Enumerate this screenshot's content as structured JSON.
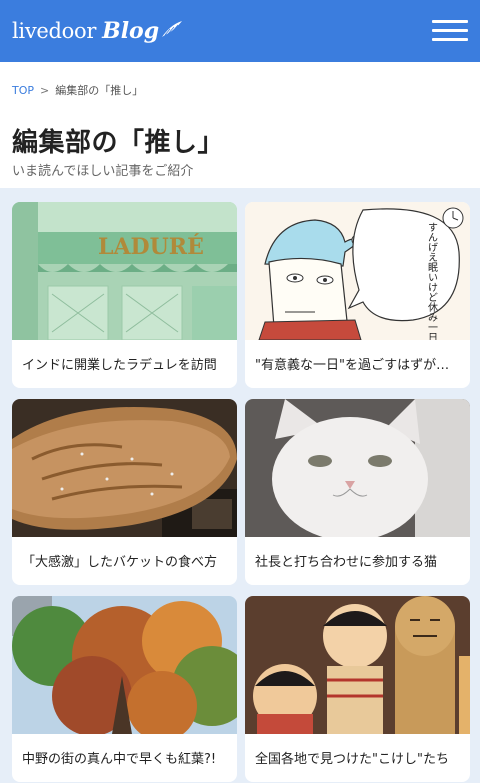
{
  "header": {
    "logo_text": "livedoor",
    "logo_blog": "Blog",
    "menu_icon": "hamburger-menu-icon"
  },
  "breadcrumb": {
    "top_label": "TOP",
    "separator": ">",
    "current_label": "編集部の「推し」"
  },
  "page": {
    "title": "編集部の「推し」",
    "subtitle": "いま読んでほしい記事をご紹介"
  },
  "articles": [
    {
      "title": "インドに開業したラデュレを訪問",
      "image_text": "LADURÉ"
    },
    {
      "title": "\"有意義な一日\"を過ごすはずが…",
      "image_text": "すんげえ眠いけど休み一日しかないし精力的に活動しないといけないね……"
    },
    {
      "title": "「大感激」したバケットの食べ方"
    },
    {
      "title": "社長と打ち合わせに参加する猫"
    },
    {
      "title": "中野の街の真ん中で早くも紅葉?!"
    },
    {
      "title": "全国各地で見つけた\"こけし\"たち"
    }
  ],
  "colors": {
    "brand_blue": "#3b7dde",
    "page_bg": "#e6eef8",
    "card_bg": "#ffffff"
  }
}
